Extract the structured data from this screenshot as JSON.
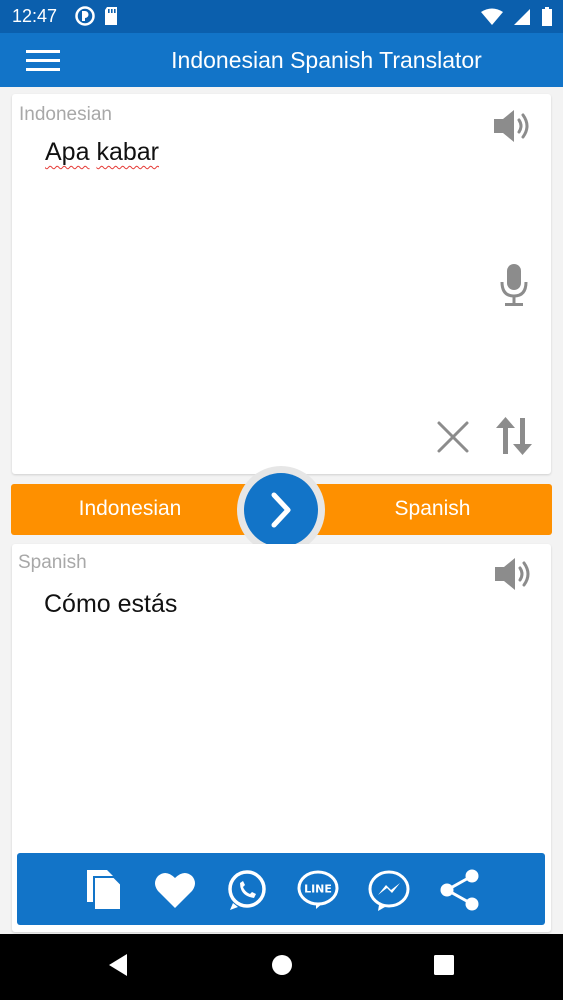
{
  "status_bar": {
    "time": "12:47"
  },
  "app_bar": {
    "title": "Indonesian Spanish Translator"
  },
  "source": {
    "language_label": "Indonesian",
    "text_words": [
      "Apa",
      "kabar"
    ]
  },
  "lang_bar": {
    "from": "Indonesian",
    "to": "Spanish"
  },
  "target": {
    "language_label": "Spanish",
    "text": "Cómo estás"
  },
  "share_bar": {
    "icons": [
      "copy-icon",
      "heart-icon",
      "whatsapp-icon",
      "line-icon",
      "messenger-icon",
      "share-icon"
    ]
  },
  "colors": {
    "primary": "#1274c8",
    "status": "#0b5fad",
    "accent": "#fe9000",
    "icon_gray": "#8c8c8c"
  }
}
